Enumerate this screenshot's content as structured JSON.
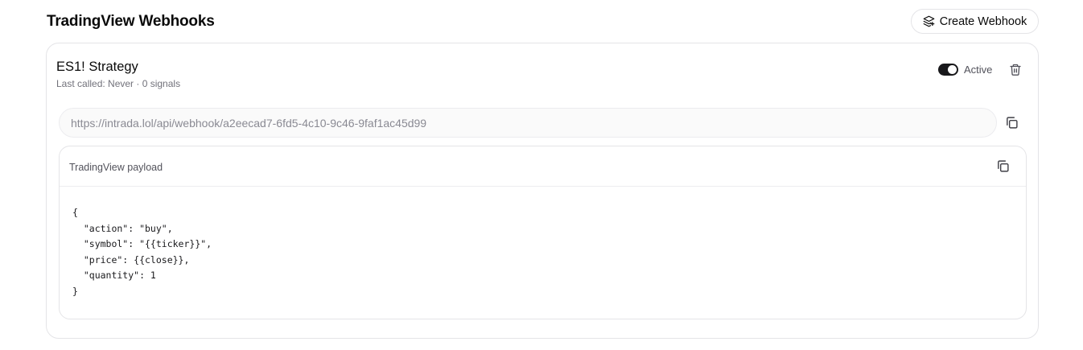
{
  "header": {
    "title": "TradingView Webhooks",
    "create_button_label": "Create Webhook"
  },
  "webhook": {
    "name": "ES1! Strategy",
    "meta": "Last called: Never · 0 signals",
    "status_label": "Active",
    "status_active": true,
    "url": "https://intrada.lol/api/webhook/a2eecad7-6fd5-4c10-9c46-9faf1ac45d99",
    "payload_title": "TradingView payload",
    "payload_lines": [
      "{",
      "  \"action\": \"buy\",",
      "  \"symbol\": \"{{ticker}}\",",
      "  \"price\": {{close}},",
      "  \"quantity\": 1",
      "}"
    ]
  },
  "icons": {
    "create": "layers-plus-icon",
    "trash": "trash-icon",
    "copy": "copy-icon"
  },
  "colors": {
    "toggle_on": "#18181b",
    "border": "#e4e4e7",
    "muted_text": "#71717a"
  }
}
